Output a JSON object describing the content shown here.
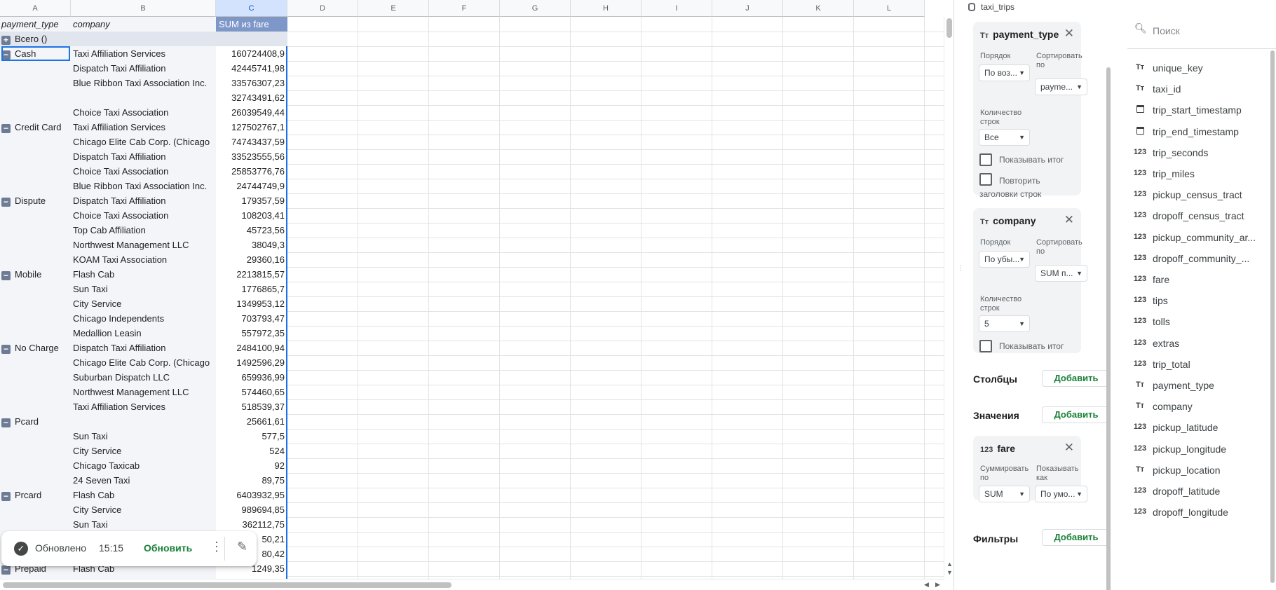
{
  "sheet": {
    "columns": [
      "A",
      "B",
      "C",
      "D",
      "E",
      "F",
      "G",
      "H",
      "I",
      "J",
      "K",
      "L"
    ],
    "header": {
      "payment_type": "payment_type",
      "company": "company",
      "value": "SUM из fare"
    },
    "total_label": "Всего ()",
    "rows": [
      {
        "pt": "Cash",
        "group": true,
        "co": "Taxi Affiliation Services",
        "val": "160724408,9"
      },
      {
        "pt": "",
        "co": "Dispatch Taxi Affiliation",
        "val": "42445741,98"
      },
      {
        "pt": "",
        "co": "Blue Ribbon Taxi Association Inc.",
        "val": "33576307,23"
      },
      {
        "pt": "",
        "co": "",
        "val": "32743491,62"
      },
      {
        "pt": "",
        "co": "Choice Taxi Association",
        "val": "26039549,44"
      },
      {
        "pt": "Credit Card",
        "group": true,
        "co": "Taxi Affiliation Services",
        "val": "127502767,1"
      },
      {
        "pt": "",
        "co": "Chicago Elite Cab Corp. (Chicago",
        "val": "74743437,59"
      },
      {
        "pt": "",
        "co": "Dispatch Taxi Affiliation",
        "val": "33523555,56"
      },
      {
        "pt": "",
        "co": "Choice Taxi Association",
        "val": "25853776,76"
      },
      {
        "pt": "",
        "co": "Blue Ribbon Taxi Association Inc.",
        "val": "24744749,9"
      },
      {
        "pt": "Dispute",
        "group": true,
        "co": "Dispatch Taxi Affiliation",
        "val": "179357,59"
      },
      {
        "pt": "",
        "co": "Choice Taxi Association",
        "val": "108203,41"
      },
      {
        "pt": "",
        "co": "Top Cab Affiliation",
        "val": "45723,56"
      },
      {
        "pt": "",
        "co": "Northwest Management LLC",
        "val": "38049,3"
      },
      {
        "pt": "",
        "co": "KOAM Taxi Association",
        "val": "29360,16"
      },
      {
        "pt": "Mobile",
        "group": true,
        "co": "Flash Cab",
        "val": "2213815,57"
      },
      {
        "pt": "",
        "co": "Sun Taxi",
        "val": "1776865,7"
      },
      {
        "pt": "",
        "co": "City Service",
        "val": "1349953,12"
      },
      {
        "pt": "",
        "co": "Chicago Independents",
        "val": "703793,47"
      },
      {
        "pt": "",
        "co": "Medallion Leasin",
        "val": "557972,35"
      },
      {
        "pt": "No Charge",
        "group": true,
        "co": "Dispatch Taxi Affiliation",
        "val": "2484100,94"
      },
      {
        "pt": "",
        "co": "Chicago Elite Cab Corp. (Chicago",
        "val": "1492596,29"
      },
      {
        "pt": "",
        "co": "Suburban Dispatch LLC",
        "val": "659936,99"
      },
      {
        "pt": "",
        "co": "Northwest Management LLC",
        "val": "574460,65"
      },
      {
        "pt": "",
        "co": "Taxi Affiliation Services",
        "val": "518539,37"
      },
      {
        "pt": "Pcard",
        "group": true,
        "co": "",
        "val": "25661,61"
      },
      {
        "pt": "",
        "co": "Sun Taxi",
        "val": "577,5"
      },
      {
        "pt": "",
        "co": "City Service",
        "val": "524"
      },
      {
        "pt": "",
        "co": "Chicago Taxicab",
        "val": "92"
      },
      {
        "pt": "",
        "co": "24 Seven Taxi",
        "val": "89,75"
      },
      {
        "pt": "Prcard",
        "group": true,
        "co": "Flash Cab",
        "val": "6403932,95"
      },
      {
        "pt": "",
        "co": "City Service",
        "val": "989694,85"
      },
      {
        "pt": "",
        "co": "Sun Taxi",
        "val": "362112,75"
      },
      {
        "pt": "",
        "co": "",
        "val": "50,21"
      },
      {
        "pt": "",
        "co": "",
        "val": "80,42"
      },
      {
        "pt": "Prepaid",
        "group": true,
        "co": "Flash Cab",
        "val": "1249,35"
      }
    ]
  },
  "toast": {
    "status": "Обновлено",
    "time": "15:15",
    "refresh_label": "Обновить"
  },
  "editor": {
    "source": "taxi_trips",
    "rows_card_1": {
      "field": "payment_type",
      "order_label": "Порядок",
      "order_value": "По воз...",
      "sort_label": "Сортировать по",
      "sort_value": "payme...",
      "count_label": "Количество строк",
      "count_value": "Все",
      "show_total": "Показывать итог",
      "repeat_headers": "Повторить заголовки строк"
    },
    "rows_card_2": {
      "field": "company",
      "order_label": "Порядок",
      "order_value": "По убы...",
      "sort_label": "Сортировать по",
      "sort_value": "SUM п...",
      "count_label": "Количество строк",
      "count_value": "5",
      "show_total": "Показывать итог"
    },
    "columns_label": "Столбцы",
    "values_label": "Значения",
    "filters_label": "Фильтры",
    "add_label": "Добавить",
    "value_card": {
      "field": "fare",
      "summarize_label": "Суммировать по",
      "summarize_value": "SUM",
      "show_as_label": "Показывать как",
      "show_as_value": "По умо..."
    },
    "search_placeholder": "Поиск",
    "fields": [
      {
        "type": "text",
        "name": "unique_key"
      },
      {
        "type": "text",
        "name": "taxi_id"
      },
      {
        "type": "date",
        "name": "trip_start_timestamp"
      },
      {
        "type": "date",
        "name": "trip_end_timestamp"
      },
      {
        "type": "num",
        "name": "trip_seconds"
      },
      {
        "type": "num",
        "name": "trip_miles"
      },
      {
        "type": "num",
        "name": "pickup_census_tract"
      },
      {
        "type": "num",
        "name": "dropoff_census_tract"
      },
      {
        "type": "num",
        "name": "pickup_community_ar..."
      },
      {
        "type": "num",
        "name": "dropoff_community_..."
      },
      {
        "type": "num",
        "name": "fare"
      },
      {
        "type": "num",
        "name": "tips"
      },
      {
        "type": "num",
        "name": "tolls"
      },
      {
        "type": "num",
        "name": "extras"
      },
      {
        "type": "num",
        "name": "trip_total"
      },
      {
        "type": "text",
        "name": "payment_type"
      },
      {
        "type": "text",
        "name": "company"
      },
      {
        "type": "num",
        "name": "pickup_latitude"
      },
      {
        "type": "num",
        "name": "pickup_longitude"
      },
      {
        "type": "text",
        "name": "pickup_location"
      },
      {
        "type": "num",
        "name": "dropoff_latitude"
      },
      {
        "type": "num",
        "name": "dropoff_longitude"
      }
    ]
  }
}
